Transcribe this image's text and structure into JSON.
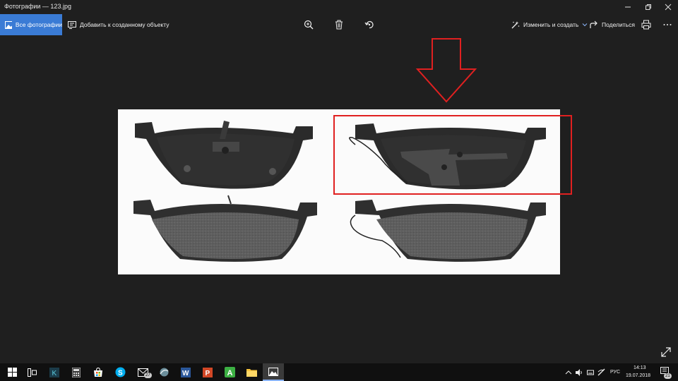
{
  "window": {
    "title": "Фотографии — 123.jpg"
  },
  "toolbar": {
    "all_photos_label": "Все фотографии",
    "add_to_creation_label": "Добавить к созданному объекту",
    "edit_create_label": "Изменить и создать",
    "share_label": "Поделиться",
    "icons": [
      "zoom-icon",
      "delete-icon",
      "rotate-icon",
      "print-icon",
      "more-icon"
    ]
  },
  "taskbar": {
    "apps": [
      "start",
      "task-view",
      "k-app",
      "calculator",
      "store",
      "skype",
      "mail",
      "network-app",
      "word",
      "powerpoint",
      "a-app",
      "file-explorer",
      "photos"
    ],
    "mail_badge": "27",
    "language": "РУС",
    "time": "14:13",
    "date": "19.07.2018",
    "notification_count": "21"
  },
  "colors": {
    "accent": "#3a7bd5",
    "annotation": "#e02020",
    "background": "#1f1f1f"
  }
}
